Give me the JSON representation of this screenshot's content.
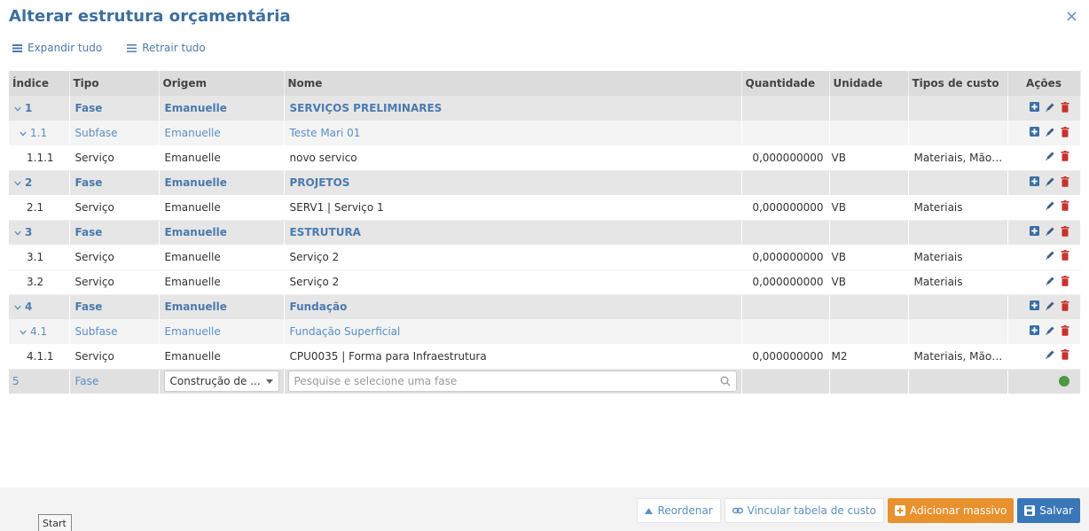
{
  "modal": {
    "title": "Alterar estrutura orçamentária",
    "close_icon": "×"
  },
  "toolbar": {
    "expand_label": "Expandir tudo",
    "collapse_label": "Retrair tudo"
  },
  "table": {
    "headers": [
      "Índice",
      "Tipo",
      "Origem",
      "Nome",
      "Quantidade",
      "Unidade",
      "Tipos de custo",
      "Ações"
    ],
    "rows": [
      {
        "kind": "fase",
        "index": "1",
        "tipo": "Fase",
        "origem": "Emanuelle",
        "nome": "SERVIÇOS PRELIMINARES",
        "qtd": "",
        "unidade": "",
        "custo": ""
      },
      {
        "kind": "subfase",
        "index": "1.1",
        "tipo": "Subfase",
        "origem": "Emanuelle",
        "nome": "Teste Mari 01",
        "qtd": "",
        "unidade": "",
        "custo": ""
      },
      {
        "kind": "serv",
        "index": "1.1.1",
        "tipo": "Serviço",
        "origem": "Emanuelle",
        "nome": "novo servico",
        "qtd": "0,000000000",
        "unidade": "VB",
        "custo": "Materiais, Mão ..."
      },
      {
        "kind": "fase",
        "index": "2",
        "tipo": "Fase",
        "origem": "Emanuelle",
        "nome": "PROJETOS",
        "qtd": "",
        "unidade": "",
        "custo": ""
      },
      {
        "kind": "serv",
        "index": "2.1",
        "tipo": "Serviço",
        "origem": "Emanuelle",
        "nome": "SERV1 | Serviço 1",
        "qtd": "0,000000000",
        "unidade": "VB",
        "custo": "Materiais"
      },
      {
        "kind": "fase",
        "index": "3",
        "tipo": "Fase",
        "origem": "Emanuelle",
        "nome": "ESTRUTURA",
        "qtd": "",
        "unidade": "",
        "custo": ""
      },
      {
        "kind": "serv",
        "index": "3.1",
        "tipo": "Serviço",
        "origem": "Emanuelle",
        "nome": "Serviço 2",
        "qtd": "0,000000000",
        "unidade": "VB",
        "custo": "Materiais"
      },
      {
        "kind": "serv",
        "index": "3.2",
        "tipo": "Serviço",
        "origem": "Emanuelle",
        "nome": "Serviço 2",
        "qtd": "0,000000000",
        "unidade": "VB",
        "custo": "Materiais"
      },
      {
        "kind": "fase",
        "index": "4",
        "tipo": "Fase",
        "origem": "Emanuelle",
        "nome": "Fundação",
        "qtd": "",
        "unidade": "",
        "custo": ""
      },
      {
        "kind": "subfase",
        "index": "4.1",
        "tipo": "Subfase",
        "origem": "Emanuelle",
        "nome": "Fundação Superficial",
        "qtd": "",
        "unidade": "",
        "custo": ""
      },
      {
        "kind": "serv",
        "index": "4.1.1",
        "tipo": "Serviço",
        "origem": "Emanuelle",
        "nome": "CPU0035 | Forma para Infraestrutura",
        "qtd": "0,000000000",
        "unidade": "M2",
        "custo": "Materiais, Mão ..."
      }
    ],
    "new_row": {
      "index": "5",
      "tipo": "Fase",
      "origem_select": "Construção de ...",
      "search_placeholder": "Pesquise e selecione uma fase"
    }
  },
  "footer": {
    "reorder_label": "Reordenar",
    "link_label": "Vincular tabela de custo",
    "bulk_label": "Adicionar massivo",
    "save_label": "Salvar"
  },
  "tooltip": {
    "text": "Start"
  },
  "colors": {
    "title": "#3c6f9e",
    "link": "#5b8fc4",
    "edit": "#3a5f87",
    "delete": "#c9312b",
    "add": "#3a6fa8",
    "orange": "#e8912d",
    "save": "#3a77b8",
    "status_dot": "#4c9a42"
  }
}
